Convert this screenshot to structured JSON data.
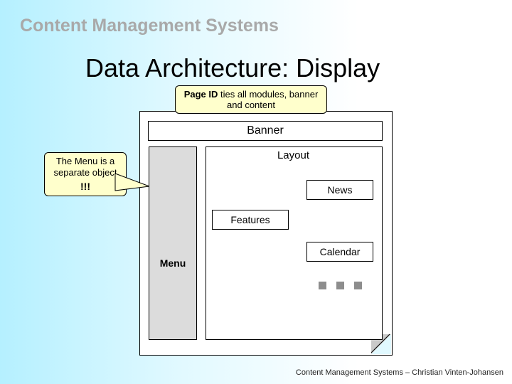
{
  "header": "Content Management Systems",
  "title": "Data Architecture: Display",
  "notes": {
    "pageid_bold": "Page ID",
    "pageid_rest": " ties all modules, banner and content",
    "menu_l1": "The Menu is a",
    "menu_l2": "separate object",
    "menu_ex": "!!!"
  },
  "panel": {
    "banner": "Banner",
    "menu": "Menu",
    "layout": "Layout",
    "features": "Features",
    "news": "News",
    "calendar": "Calendar"
  },
  "footer": "Content Management Systems – Christian Vinten-Johansen"
}
